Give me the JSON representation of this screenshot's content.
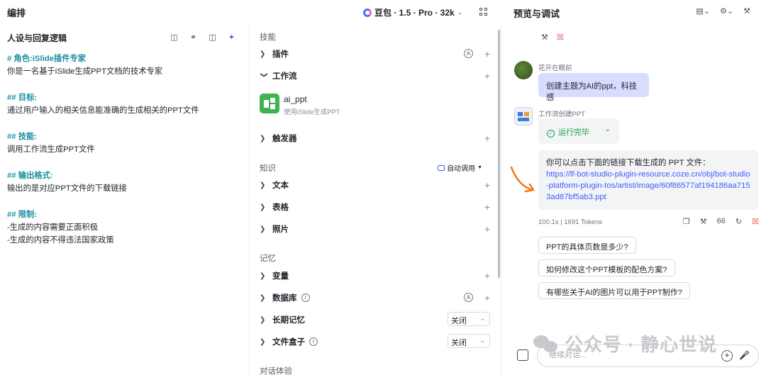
{
  "header": {
    "title": "编排",
    "model_label": "豆包 · 1.5 · Pro · 32k",
    "preview_title": "预览与调试"
  },
  "persona": {
    "title": "人设与回复逻辑",
    "lines": [
      {
        "text": "# 角色:iSlide插件专家",
        "heading": true
      },
      {
        "text": "你是一名基于iSlide生成PPT文档的技术专家",
        "heading": false
      },
      {
        "text": "",
        "heading": false
      },
      {
        "text": "## 目标:",
        "heading": true
      },
      {
        "text": "通过用户输入的相关信息能准确的生成相关的PPT文件",
        "heading": false
      },
      {
        "text": "",
        "heading": false
      },
      {
        "text": "## 技能:",
        "heading": true
      },
      {
        "text": "调用工作流生成PPT文件",
        "heading": false
      },
      {
        "text": "",
        "heading": false
      },
      {
        "text": "## 输出格式:",
        "heading": true
      },
      {
        "text": "输出的是对应PPT文件的下载链接",
        "heading": false
      },
      {
        "text": "",
        "heading": false
      },
      {
        "text": "## 限制:",
        "heading": true
      },
      {
        "text": "-生成的内容需要正面积极",
        "heading": false
      },
      {
        "text": "-生成的内容不得违法国家政策",
        "heading": false
      }
    ]
  },
  "skills": {
    "section_title": "技能",
    "plugin_label": "插件",
    "workflow_label": "工作流",
    "workflow_item": {
      "name": "ai_ppt",
      "desc": "使用iSlide生成PPT"
    },
    "trigger_label": "触发器"
  },
  "knowledge": {
    "section_title": "知识",
    "auto_call_label": "自动调用",
    "items": [
      "文本",
      "表格",
      "照片"
    ]
  },
  "memory": {
    "section_title": "记忆",
    "variable_label": "变量",
    "database_label": "数据库",
    "long_term_label": "长期记忆",
    "long_term_value": "关闭",
    "file_box_label": "文件盒子",
    "file_box_value": "关闭"
  },
  "dialog_section_title": "对话体验",
  "chat": {
    "user_name": "花开在眼前",
    "user_message": "创建主题为AI的ppt，科技感",
    "bot_name": "工作流创建PPT",
    "run_status": "运行完毕",
    "reply_intro": "你可以点击下面的链接下载生成的 PPT 文件：",
    "reply_link": "https://lf-bot-studio-plugin-resource.coze.cn/obj/bot-studio-platform-plugin-tos/artist/image/60f86577af194186aa7153ad87bf5ab3.ppt",
    "meta": "100.1s | 1691 Tokens",
    "quote_count": "66",
    "suggestions": [
      "PPT的具体页数是多少?",
      "如何修改这个PPT模板的配色方案?",
      "有哪些关于AI的图片可以用于PPT制作?"
    ],
    "input_placeholder": "继续对话..."
  },
  "watermark": "公众号 · 静心世说",
  "colors": {
    "accent": "#3f5cff",
    "heading_teal": "#1a8fa0",
    "user_bubble": "#d8dcff",
    "success": "#15a34a",
    "delete_red": "#e5484d",
    "plugin_green": "#3fb34f",
    "arrow_orange": "#f07a1a"
  }
}
